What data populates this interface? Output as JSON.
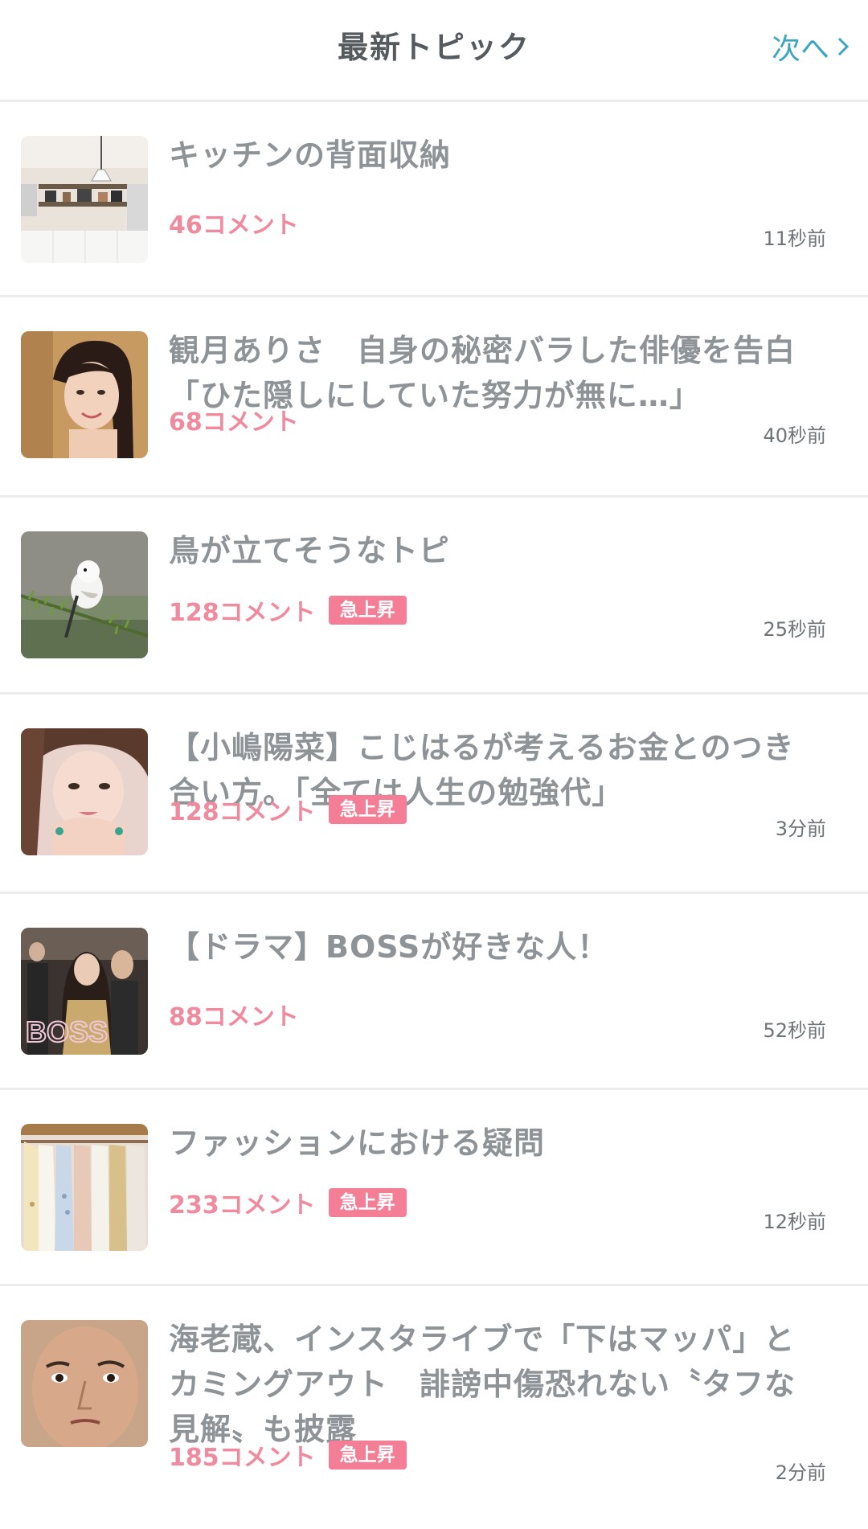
{
  "header": {
    "title": "最新トピック",
    "next_label": "次へ"
  },
  "colors": {
    "accent": "#3aa6c1",
    "comment": "#f08a9e",
    "badge": "#f47e95",
    "title": "#8e9397"
  },
  "topics": [
    {
      "title": "キッチンの背面収納",
      "comments": "46コメント",
      "badge": "",
      "time": "11秒前",
      "thumb": "kitchen"
    },
    {
      "title": "観月ありさ　自身の秘密バラした俳優を告白「ひた隠しにしていた努力が無に…」",
      "comments": "68コメント",
      "badge": "",
      "time": "40秒前",
      "thumb": "woman-portrait"
    },
    {
      "title": "鳥が立てそうなトピ",
      "comments": "128コメント",
      "badge": "急上昇",
      "time": "25秒前",
      "thumb": "bird"
    },
    {
      "title": "【小嶋陽菜】こじはるが考えるお金とのつき合い方。「全ては人生の勉強代」",
      "comments": "128コメント",
      "badge": "急上昇",
      "time": "3分前",
      "thumb": "woman-closeup"
    },
    {
      "title": "【ドラマ】BOSSが好きな人！",
      "comments": "88コメント",
      "badge": "",
      "time": "52秒前",
      "thumb": "drama-poster"
    },
    {
      "title": "ファッションにおける疑問",
      "comments": "233コメント",
      "badge": "急上昇",
      "time": "12秒前",
      "thumb": "clothes-rack"
    },
    {
      "title": "海老蔵、インスタライブで「下はマッパ」とカミングアウト　誹謗中傷恐れない〝タフな見解〟も披露",
      "comments": "185コメント",
      "badge": "急上昇",
      "time": "2分前",
      "thumb": "man-face"
    }
  ]
}
